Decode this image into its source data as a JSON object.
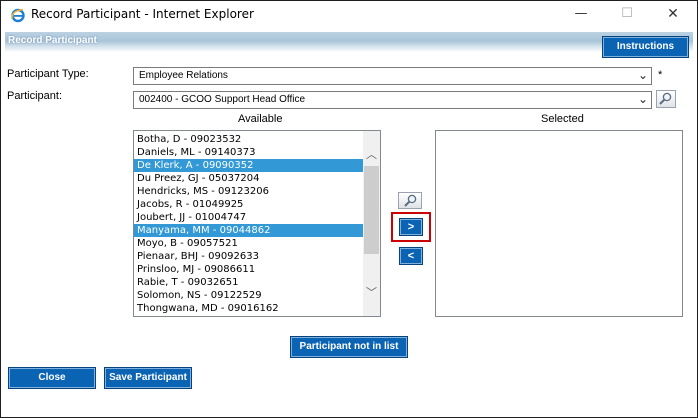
{
  "window": {
    "title": "Record Participant - Internet Explorer",
    "controls": {
      "minimize": "—",
      "maximize": "☐",
      "close": "✕"
    }
  },
  "header": {
    "title": "Record Participant",
    "instructions_label": "Instructions"
  },
  "form": {
    "participant_type_label": "Participant Type:",
    "participant_type_value": "Employee Relations",
    "required_marker": "*",
    "participant_label": "Participant:",
    "participant_value": "002400 - GCOO Support Head Office"
  },
  "available": {
    "header": "Available",
    "items": [
      {
        "text": "Botha, D - 09023532",
        "selected": false
      },
      {
        "text": "Daniels, ML - 09140373",
        "selected": false
      },
      {
        "text": "De Klerk, A - 09090352",
        "selected": true
      },
      {
        "text": "Du Preez, GJ - 05037204",
        "selected": false
      },
      {
        "text": "Hendricks, MS - 09123206",
        "selected": false
      },
      {
        "text": "Jacobs, R - 01049925",
        "selected": false
      },
      {
        "text": "Joubert, JJ - 01004747",
        "selected": false
      },
      {
        "text": "Manyama, MM - 09044862",
        "selected": true
      },
      {
        "text": "Moyo, B - 09057521",
        "selected": false
      },
      {
        "text": "Pienaar, BHJ - 09092633",
        "selected": false
      },
      {
        "text": "Prinsloo, MJ - 09086611",
        "selected": false
      },
      {
        "text": "Rabie, T - 09032651",
        "selected": false
      },
      {
        "text": "Solomon, NS - 09122529",
        "selected": false
      },
      {
        "text": "Thongwana, MD - 09016162",
        "selected": false
      }
    ]
  },
  "selected": {
    "header": "Selected",
    "items": []
  },
  "transfer": {
    "add_label": ">",
    "remove_label": "<"
  },
  "buttons": {
    "not_in_list": "Participant not in list",
    "close": "Close",
    "save": "Save Participant"
  },
  "colors": {
    "button_blue": "#0b63b4",
    "selection": "#3399d6",
    "highlight_red": "#cc0000"
  }
}
